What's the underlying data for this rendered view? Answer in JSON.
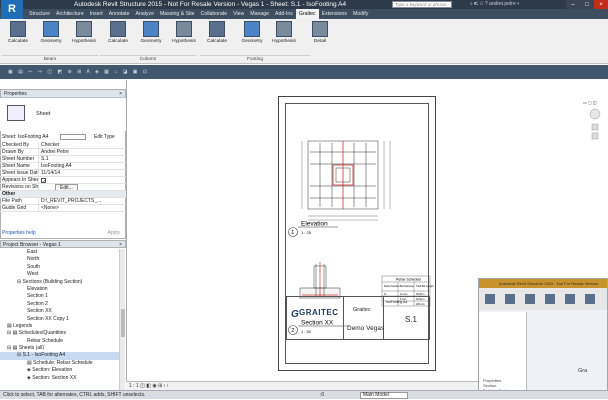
{
  "app": {
    "logo": "R",
    "title": "Autodesk Revit Structure 2015 - Not For Resale Version -  Vegas 1 - Sheet: S.1 - IsoFooting A4",
    "search_placeholder": "Type a keyword or phrase",
    "user": "andrei.petre"
  },
  "window_controls": {
    "minimize": "–",
    "maximize": "□",
    "close": "×"
  },
  "tabs": [
    "Structure",
    "Architecture",
    "Insert",
    "Annotate",
    "Analyze",
    "Massing & Site",
    "Collaborate",
    "View",
    "Manage",
    "Add-Ins",
    "Graitec",
    "Extensions",
    "Modify"
  ],
  "active_tab": "Graitec",
  "ribbon": {
    "tools": [
      "Calculate",
      "Geometry",
      "Hypothesis",
      "Calculate",
      "Geometry",
      "Hypothesis",
      "Calculate",
      "Geometry",
      "Hypothesis",
      "Detail"
    ],
    "groups": [
      "Beam",
      "Column",
      "Footing"
    ]
  },
  "properties": {
    "header": "Properties",
    "type_name": "Sheet",
    "selector": "Sheet: IsoFooting A4",
    "edit_type": "Edit Type",
    "rows": [
      {
        "k": "Checked By",
        "v": "Checker"
      },
      {
        "k": "Drawn By",
        "v": "Andrei Petre"
      },
      {
        "k": "Sheet Number",
        "v": "S.1"
      },
      {
        "k": "Sheet Name",
        "v": "IsoFooting A4"
      },
      {
        "k": "Sheet Issue Date",
        "v": "11/14/14"
      },
      {
        "k": "Appears In Sheet List",
        "v": ""
      },
      {
        "k": "Revisions on Sheet",
        "v": "Edit..."
      }
    ],
    "other_header": "Other",
    "other_rows": [
      {
        "k": "File Path",
        "v": "D:\\_REVIT_PROJECTS_..."
      },
      {
        "k": "Guide Grid",
        "v": "<None>"
      }
    ],
    "help": "Properties help",
    "apply": "Apply"
  },
  "project_browser": {
    "header": "Project Browser - Vegas 1",
    "nodes": [
      {
        "label": "East",
        "indent": 5,
        "sel": false
      },
      {
        "label": "North",
        "indent": 5,
        "sel": false
      },
      {
        "label": "South",
        "indent": 5,
        "sel": false
      },
      {
        "label": "West",
        "indent": 5,
        "sel": false
      },
      {
        "label": "⊟ Sections (Building Section)",
        "indent": 3,
        "sel": false
      },
      {
        "label": "Elevation",
        "indent": 5,
        "sel": false
      },
      {
        "label": "Section 1",
        "indent": 5,
        "sel": false
      },
      {
        "label": "Section 2",
        "indent": 5,
        "sel": false
      },
      {
        "label": "Section XX",
        "indent": 5,
        "sel": false
      },
      {
        "label": "Section XX Copy 1",
        "indent": 5,
        "sel": false
      },
      {
        "label": "▤ Legends",
        "indent": 1,
        "sel": false
      },
      {
        "label": "⊟ ▤ Schedules/Quantities",
        "indent": 1,
        "sel": false
      },
      {
        "label": "Rebar Schedule",
        "indent": 5,
        "sel": false
      },
      {
        "label": "⊟ ▤ Sheets (all)",
        "indent": 1,
        "sel": false
      },
      {
        "label": "⊟ S.1 - IsoFooting A4",
        "indent": 3,
        "sel": true
      },
      {
        "label": "▤ Schedule: Rebar Schedule",
        "indent": 5,
        "sel": false
      },
      {
        "label": "◈ Section: Elevation",
        "indent": 5,
        "sel": false
      },
      {
        "label": "◈ Section: Section XX",
        "indent": 5,
        "sel": false
      }
    ]
  },
  "sheet": {
    "view1_num": "1",
    "view1_title": "Elevation",
    "view1_scale": "1 : 25",
    "view2_num": "2",
    "view2_title": "Section XX",
    "view2_scale": "1 : 50",
    "schedule_title": "Rebar Schedule",
    "schedule_headers": [
      "Rebar Number",
      "Bar Diameter",
      "Total Bar Length"
    ],
    "schedule_rows": [
      [
        "11",
        "12 mm",
        "39.00 m"
      ],
      [
        "",
        "8 mm",
        "30.00 m"
      ],
      [
        "",
        "",
        "200 mm"
      ]
    ],
    "tb_company": "GRAITEC",
    "tb_sub": "Graitec",
    "tb_project": "Demo Vegas",
    "tb_sheet_name": "IsoFooting A4",
    "tb_sheet_num": "S.1"
  },
  "inset": {
    "title": "Autodesk Revit Structure 2015 - Not For Resale Version",
    "lines": "Properties\nSection\nBuilding Section\n\nProject Browser - Vegas 1"
  },
  "graitec_ref": "Gra",
  "canvas_strip": "1 : 1   ◫  ◧  ◉  ⊞  ‹ ›",
  "status": {
    "hint": "Click to select, TAB for alternates, CTRL adds, SHIFT unselects.",
    "filter": ":0",
    "model": "Main Model"
  }
}
